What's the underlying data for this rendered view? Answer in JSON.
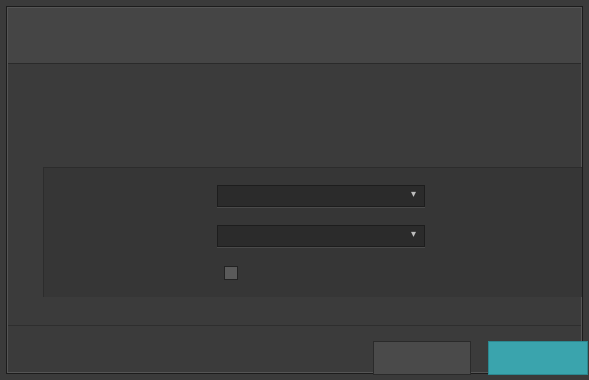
{
  "dialog": {
    "title": "",
    "description": "",
    "section_title": "",
    "fields": [
      {
        "label": "",
        "value": ""
      },
      {
        "label": "",
        "value": ""
      }
    ],
    "checkbox": {
      "label": "",
      "checked": false
    },
    "buttons": {
      "cancel": "",
      "ok": ""
    }
  },
  "icons": {
    "dropdown": "chevron-down-icon"
  },
  "colors": {
    "primary_button": "#3aa4ad",
    "background": "#3b3b3b"
  }
}
